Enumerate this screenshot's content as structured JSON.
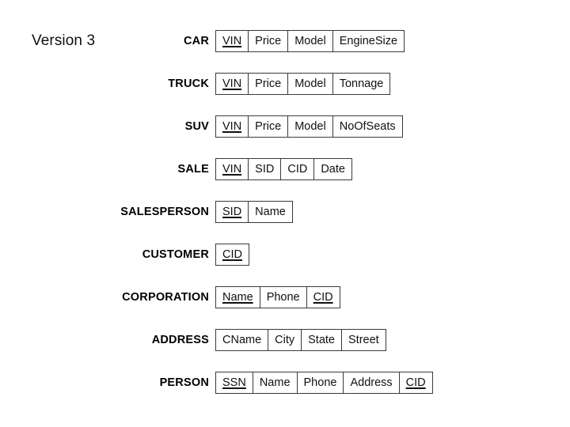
{
  "title": "Version 3",
  "colors": {
    "background": "#ffffff",
    "border": "#3a3a3a",
    "text": "#111111"
  },
  "relations": [
    {
      "name": "CAR",
      "attributes": [
        {
          "label": "VIN",
          "key": true
        },
        {
          "label": "Price",
          "key": false
        },
        {
          "label": "Model",
          "key": false
        },
        {
          "label": "EngineSize",
          "key": false
        }
      ]
    },
    {
      "name": "TRUCK",
      "attributes": [
        {
          "label": "VIN",
          "key": true
        },
        {
          "label": "Price",
          "key": false
        },
        {
          "label": "Model",
          "key": false
        },
        {
          "label": "Tonnage",
          "key": false
        }
      ]
    },
    {
      "name": "SUV",
      "attributes": [
        {
          "label": "VIN",
          "key": true
        },
        {
          "label": "Price",
          "key": false
        },
        {
          "label": "Model",
          "key": false
        },
        {
          "label": "NoOfSeats",
          "key": false
        }
      ]
    },
    {
      "name": "SALE",
      "attributes": [
        {
          "label": "VIN",
          "key": true
        },
        {
          "label": "SID",
          "key": false
        },
        {
          "label": "CID",
          "key": false
        },
        {
          "label": "Date",
          "key": false
        }
      ]
    },
    {
      "name": "SALESPERSON",
      "attributes": [
        {
          "label": "SID",
          "key": true
        },
        {
          "label": "Name",
          "key": false
        }
      ]
    },
    {
      "name": "CUSTOMER",
      "attributes": [
        {
          "label": "CID",
          "key": true
        }
      ]
    },
    {
      "name": "CORPORATION",
      "attributes": [
        {
          "label": "Name",
          "key": true
        },
        {
          "label": "Phone",
          "key": false
        },
        {
          "label": "CID",
          "key": true
        }
      ]
    },
    {
      "name": "ADDRESS",
      "attributes": [
        {
          "label": "CName",
          "key": false
        },
        {
          "label": "City",
          "key": false
        },
        {
          "label": "State",
          "key": false
        },
        {
          "label": "Street",
          "key": false
        }
      ]
    },
    {
      "name": "PERSON",
      "attributes": [
        {
          "label": "SSN",
          "key": true
        },
        {
          "label": "Name",
          "key": false
        },
        {
          "label": "Phone",
          "key": false
        },
        {
          "label": "Address",
          "key": false
        },
        {
          "label": "CID",
          "key": true
        }
      ]
    }
  ]
}
